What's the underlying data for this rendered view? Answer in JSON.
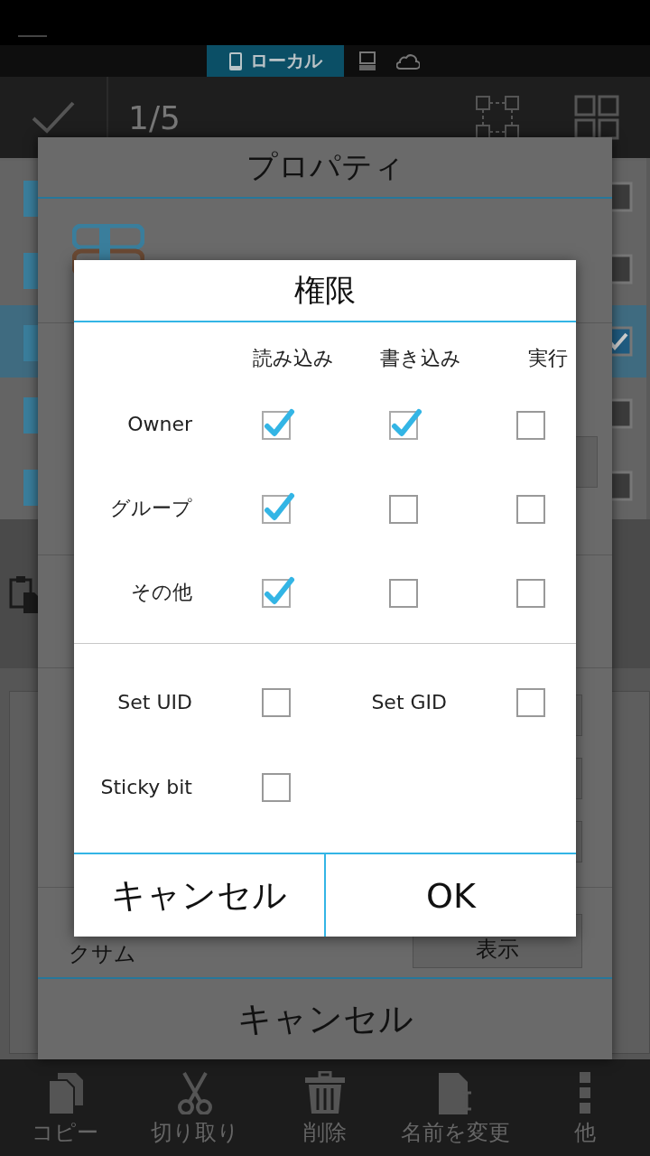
{
  "source_tabs": [
    {
      "kind": "device",
      "label": "ローカル",
      "selected": true
    },
    {
      "kind": "computer",
      "selected": false
    },
    {
      "kind": "cloud",
      "selected": false
    }
  ],
  "toolbar": {
    "counter": "1/5"
  },
  "file_list": [
    {
      "checked": false,
      "selected": false
    },
    {
      "checked": false,
      "selected": false
    },
    {
      "checked": true,
      "selected": true
    },
    {
      "checked": false,
      "selected": false
    },
    {
      "checked": false,
      "selected": false
    }
  ],
  "bottom_bar": [
    {
      "kind": "copy",
      "label": "コピー"
    },
    {
      "kind": "cut",
      "label": "切り取り"
    },
    {
      "kind": "delete",
      "label": "削除"
    },
    {
      "kind": "rename",
      "label": "名前を変更"
    },
    {
      "kind": "more",
      "label": "他"
    }
  ],
  "properties_dialog": {
    "title": "プロパティ",
    "checksum_label": "クサム",
    "checksum_button": "表示",
    "cancel_button": "キャンセル"
  },
  "permissions_dialog": {
    "title": "権限",
    "columns": [
      "読み込み",
      "書き込み",
      "実行"
    ],
    "rows": [
      {
        "label": "Owner",
        "checks": [
          {
            "checked": true
          },
          {
            "checked": true
          },
          {
            "checked": false
          }
        ]
      },
      {
        "label": "グループ",
        "checks": [
          {
            "checked": true
          },
          {
            "checked": false
          },
          {
            "checked": false
          }
        ]
      },
      {
        "label": "その他",
        "checks": [
          {
            "checked": true
          },
          {
            "checked": false
          },
          {
            "checked": false
          }
        ]
      }
    ],
    "special": [
      {
        "label": "Set UID",
        "checked": false
      },
      {
        "label": "Set GID",
        "checked": false
      },
      {
        "label": "Sticky bit",
        "checked": false
      }
    ],
    "buttons": [
      {
        "label": "キャンセル"
      },
      {
        "label": "OK"
      }
    ]
  }
}
